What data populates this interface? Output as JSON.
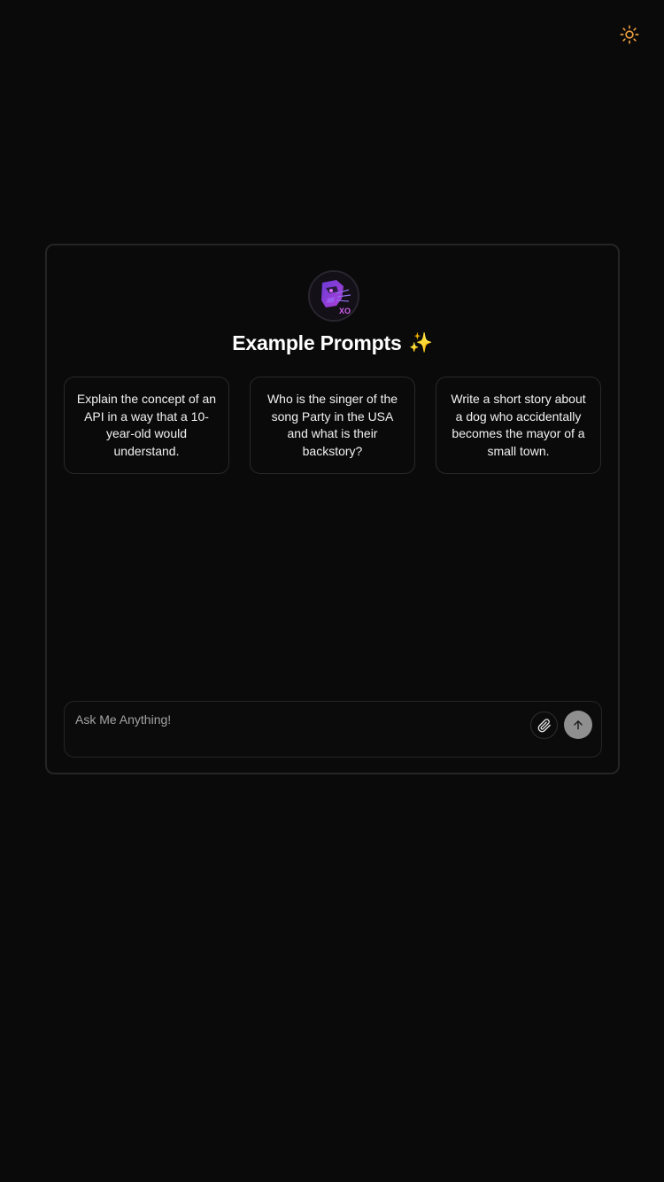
{
  "header": {
    "theme_toggle_icon": "sun-icon",
    "accent_color": "#f0a040"
  },
  "main": {
    "avatar_icon": "robot-avatar",
    "avatar_text": "XO",
    "title": "Example Prompts",
    "title_emoji": "✨",
    "prompts": [
      {
        "text": "Explain the concept of an API in a way that a 10-year-old would understand."
      },
      {
        "text": "Who is the singer of the song Party in the USA and what is their backstory?"
      },
      {
        "text": "Write a short story about a dog who accidentally becomes the mayor of a small town."
      }
    ]
  },
  "composer": {
    "placeholder": "Ask Me Anything!",
    "attach_icon": "paperclip-icon",
    "send_icon": "arrow-up-icon"
  }
}
